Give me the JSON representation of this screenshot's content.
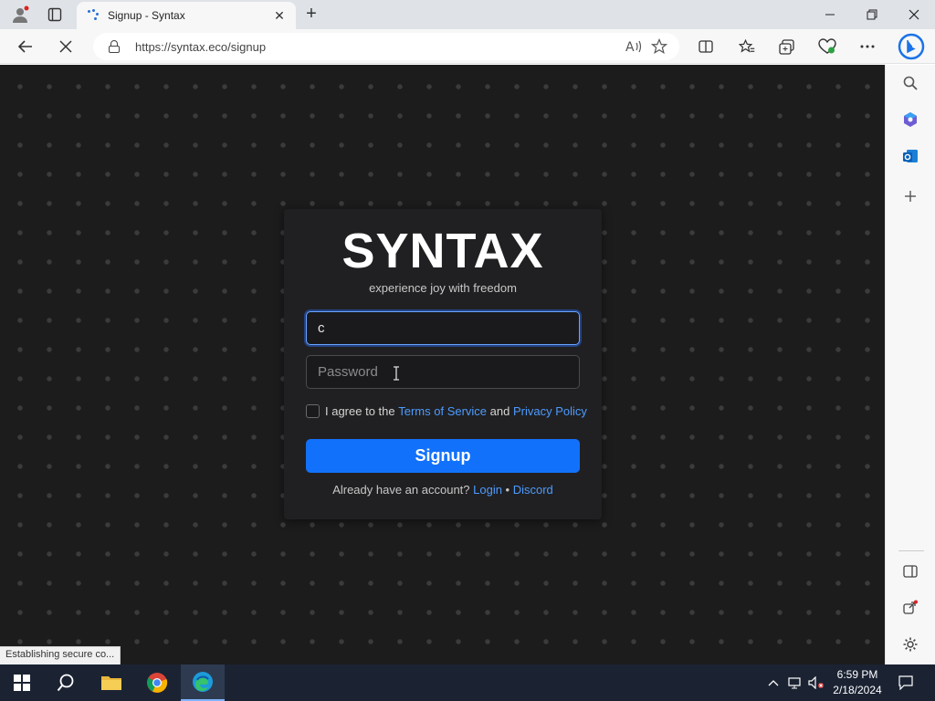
{
  "browser": {
    "tab_title": "Signup - Syntax",
    "tab_close": "✕",
    "new_tab": "+",
    "url": "https://syntax.eco/signup",
    "status_text": "Establishing secure co..."
  },
  "form": {
    "logo": "SYNTAX",
    "tagline": "experience joy with freedom",
    "username_value": "c",
    "password_placeholder": "Password",
    "agree_prefix": "I agree to the ",
    "terms_link": "Terms of Service",
    "agree_and": " and ",
    "privacy_link": "Privacy Policy",
    "signup_label": "Signup",
    "already_text": "Already have an account? ",
    "login_link": "Login",
    "separator": " • ",
    "discord_link": "Discord"
  },
  "taskbar": {
    "time": "6:59 PM",
    "date": "2/18/2024"
  },
  "colors": {
    "accent": "#1271fb",
    "link": "#4d9bff",
    "page_bg": "#1c1c1c",
    "card_bg": "#202022"
  }
}
